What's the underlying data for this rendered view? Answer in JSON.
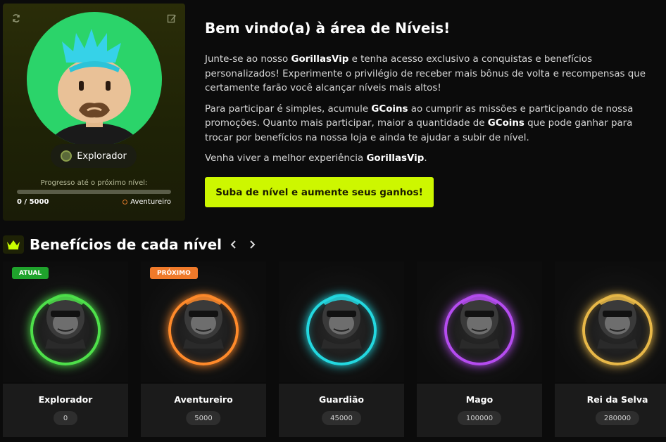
{
  "profile": {
    "rank": "Explorador",
    "progress_label": "Progresso até o próximo nível:",
    "progress_value": "0 / 5000",
    "progress_fraction": 0,
    "next_rank": "Aventureiro"
  },
  "intro": {
    "title": "Bem vindo(a) à área de Níveis!",
    "p1": [
      {
        "t": "Junte-se ao nosso ",
        "b": false
      },
      {
        "t": "GorillasVip",
        "b": true
      },
      {
        "t": " e tenha acesso exclusivo a conquistas e benefícios personalizados! Experimente o privilégio de receber mais bônus de volta e recompensas que certamente farão você alcançar níveis mais altos!",
        "b": false
      }
    ],
    "p2": [
      {
        "t": "Para participar é simples, acumule ",
        "b": false
      },
      {
        "t": "GCoins",
        "b": true
      },
      {
        "t": " ao cumprir as missões e participando de nossa promoções. Quanto mais participar, maior a quantidade de ",
        "b": false
      },
      {
        "t": "GCoins",
        "b": true
      },
      {
        "t": " que pode ganhar para trocar por benefícios na nossa loja e ainda te ajudar a subir de nível.",
        "b": false
      }
    ],
    "p3": [
      {
        "t": "Venha viver a melhor experiência ",
        "b": false
      },
      {
        "t": "GorillasVip",
        "b": true
      },
      {
        "t": ".",
        "b": false
      }
    ],
    "cta": "Suba de nível e aumente seus ganhos!"
  },
  "section": {
    "title": "Benefícios de cada nível",
    "prev_icon": "chevron-left-icon",
    "next_icon": "chevron-right-icon"
  },
  "levels": [
    {
      "name": "Explorador",
      "xp": "0",
      "badge": "ATUAL",
      "badge_color": "#1fa32c",
      "ring": "#4ee04a"
    },
    {
      "name": "Aventureiro",
      "xp": "5000",
      "badge": "PRÓXIMO",
      "badge_color": "#f07a2a",
      "ring": "#ff8a2a"
    },
    {
      "name": "Guardião",
      "xp": "45000",
      "badge": "",
      "badge_color": "",
      "ring": "#23d8e0"
    },
    {
      "name": "Mago",
      "xp": "100000",
      "badge": "",
      "badge_color": "",
      "ring": "#b54cf0"
    },
    {
      "name": "Rei da Selva",
      "xp": "280000",
      "badge": "",
      "badge_color": "",
      "ring": "#e8b848"
    }
  ],
  "colors": {
    "accent": "#cdf700",
    "avatar_bg": "#2bd46a"
  }
}
